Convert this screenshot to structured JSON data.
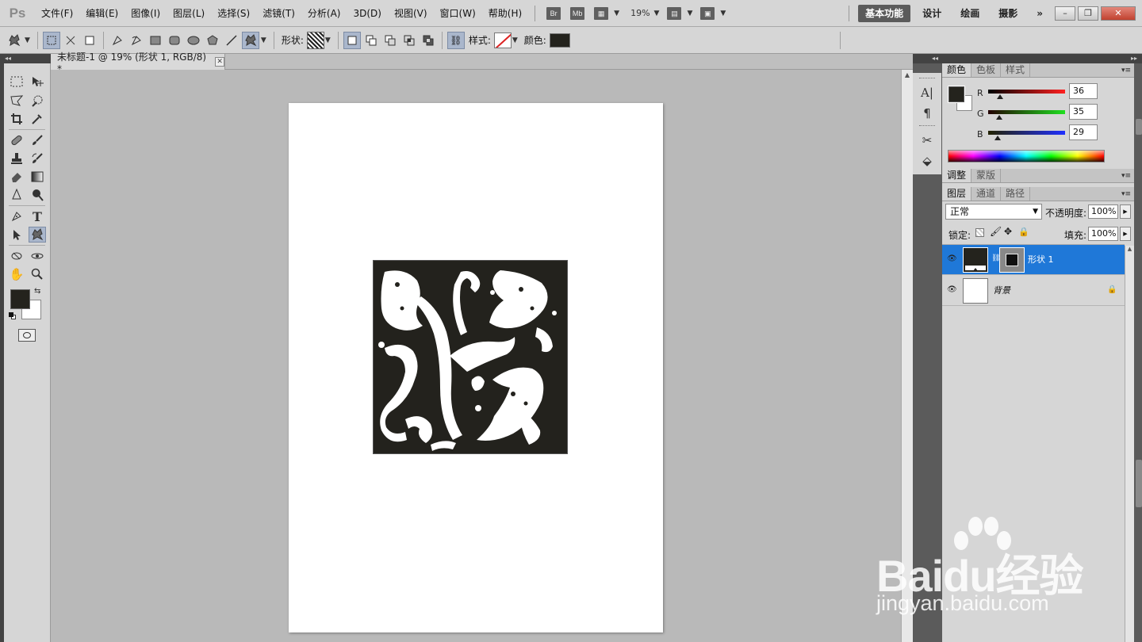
{
  "app": {
    "logo": "Ps"
  },
  "menu": [
    "文件(F)",
    "编辑(E)",
    "图像(I)",
    "图层(L)",
    "选择(S)",
    "滤镜(T)",
    "分析(A)",
    "3D(D)",
    "视图(V)",
    "窗口(W)",
    "帮助(H)"
  ],
  "menubar_icons": {
    "bridge": "Br",
    "mini_bridge": "Mb"
  },
  "zoom": "19%",
  "workspaces": [
    "基本功能",
    "设计",
    "绘画",
    "摄影"
  ],
  "workspace_more": "»",
  "window_controls": {
    "minimize": "–",
    "restore": "❐",
    "close": "✕"
  },
  "options": {
    "shape_label": "形状:",
    "style_label": "样式:",
    "color_label": "颜色:",
    "color_value": "#24231d"
  },
  "document": {
    "tab_title": "未标题-1 @ 19% (形状 1, RGB/8) *",
    "close": "✕",
    "shape_fill": "#23221d"
  },
  "colors": {
    "foreground": "#24231d",
    "background": "#ffffff"
  },
  "color_panel": {
    "tabs": [
      "颜色",
      "色板",
      "样式"
    ],
    "channels": [
      {
        "label": "R",
        "value": "36"
      },
      {
        "label": "G",
        "value": "35"
      },
      {
        "label": "B",
        "value": "29"
      }
    ]
  },
  "adjust_panel": {
    "tabs": [
      "调整",
      "蒙版"
    ]
  },
  "layers_panel": {
    "tabs": [
      "图层",
      "通道",
      "路径"
    ],
    "blend_mode": "正常",
    "opacity_label": "不透明度:",
    "opacity": "100%",
    "lock_label": "锁定:",
    "fill_label": "填充:",
    "fill": "100%",
    "layers": [
      {
        "name": "形状 1",
        "selected": true
      },
      {
        "name": "背景",
        "selected": false
      }
    ]
  },
  "watermark": {
    "brand": "Baidu经验",
    "url": "jingyan.baidu.com"
  }
}
